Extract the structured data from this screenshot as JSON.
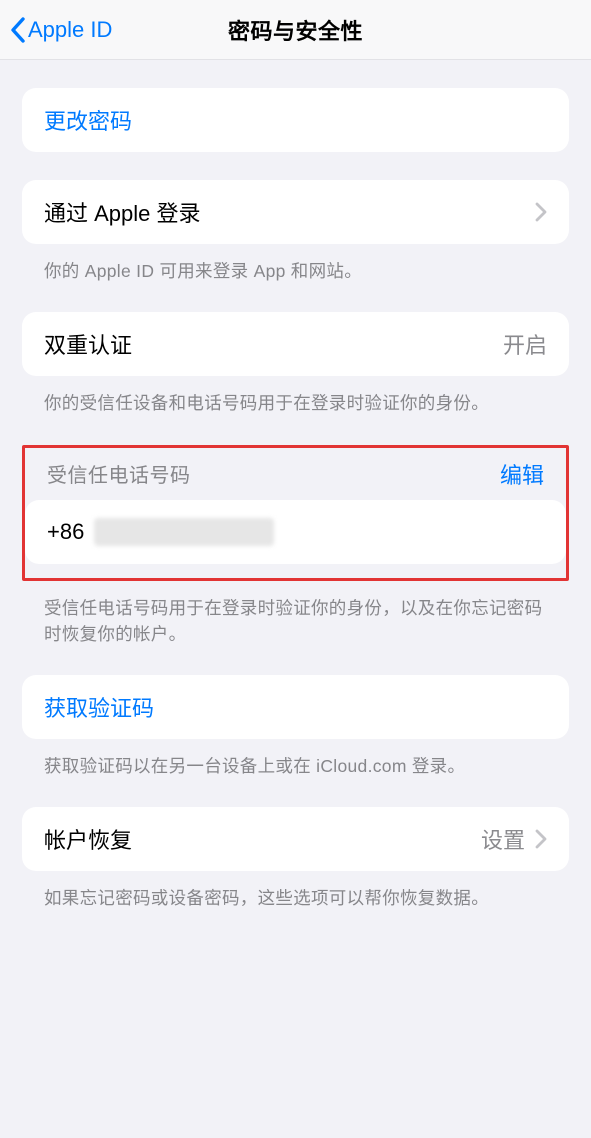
{
  "nav": {
    "back_label": "Apple ID",
    "title": "密码与安全性"
  },
  "change_password": {
    "label": "更改密码"
  },
  "signin_apple": {
    "label": "通过 Apple 登录",
    "footer": "你的 Apple ID 可用来登录 App 和网站。"
  },
  "two_factor": {
    "label": "双重认证",
    "value": "开启",
    "footer": "你的受信任设备和电话号码用于在登录时验证你的身份。"
  },
  "trusted_phone": {
    "header": "受信任电话号码",
    "edit": "编辑",
    "prefix": "+86",
    "footer": "受信任电话号码用于在登录时验证你的身份，以及在你忘记密码时恢复你的帐户。"
  },
  "get_code": {
    "label": "获取验证码",
    "footer": "获取验证码以在另一台设备上或在 iCloud.com 登录。"
  },
  "account_recovery": {
    "label": "帐户恢复",
    "value": "设置",
    "footer": "如果忘记密码或设备密码，这些选项可以帮你恢复数据。"
  }
}
